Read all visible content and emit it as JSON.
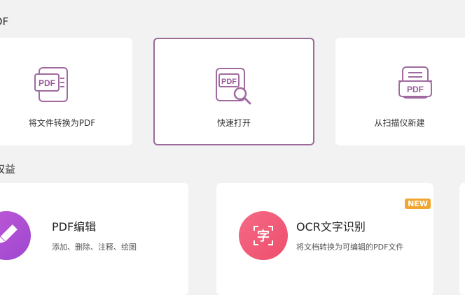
{
  "section1": {
    "title": "DF"
  },
  "quick_actions": [
    {
      "label": "将文件转换为PDF",
      "icon": "pdf-convert-icon",
      "icon_text": "PDF"
    },
    {
      "label": "快速打开",
      "icon": "pdf-search-icon",
      "icon_text": "PDF"
    },
    {
      "label": "从扫描仪新建",
      "icon": "pdf-scanner-icon",
      "icon_text": "PDF"
    }
  ],
  "section2": {
    "title": "权益"
  },
  "features": [
    {
      "title": "PDF编辑",
      "desc": "添加、删除、注释、绘图",
      "icon": "pencil-icon"
    },
    {
      "title": "OCR文字识别",
      "desc": "将文档转换为可编辑的PDF文件",
      "icon": "ocr-char-icon",
      "icon_char": "字",
      "badge": "NEW"
    }
  ],
  "colors": {
    "accent": "#9a6a9a",
    "icon_stroke": "#a06ba0",
    "pencil_gradient": [
      "#c05ad6",
      "#9d46d0"
    ],
    "ocr_gradient": [
      "#f46a86",
      "#ee4e6c"
    ],
    "badge": "#f3a62f"
  }
}
